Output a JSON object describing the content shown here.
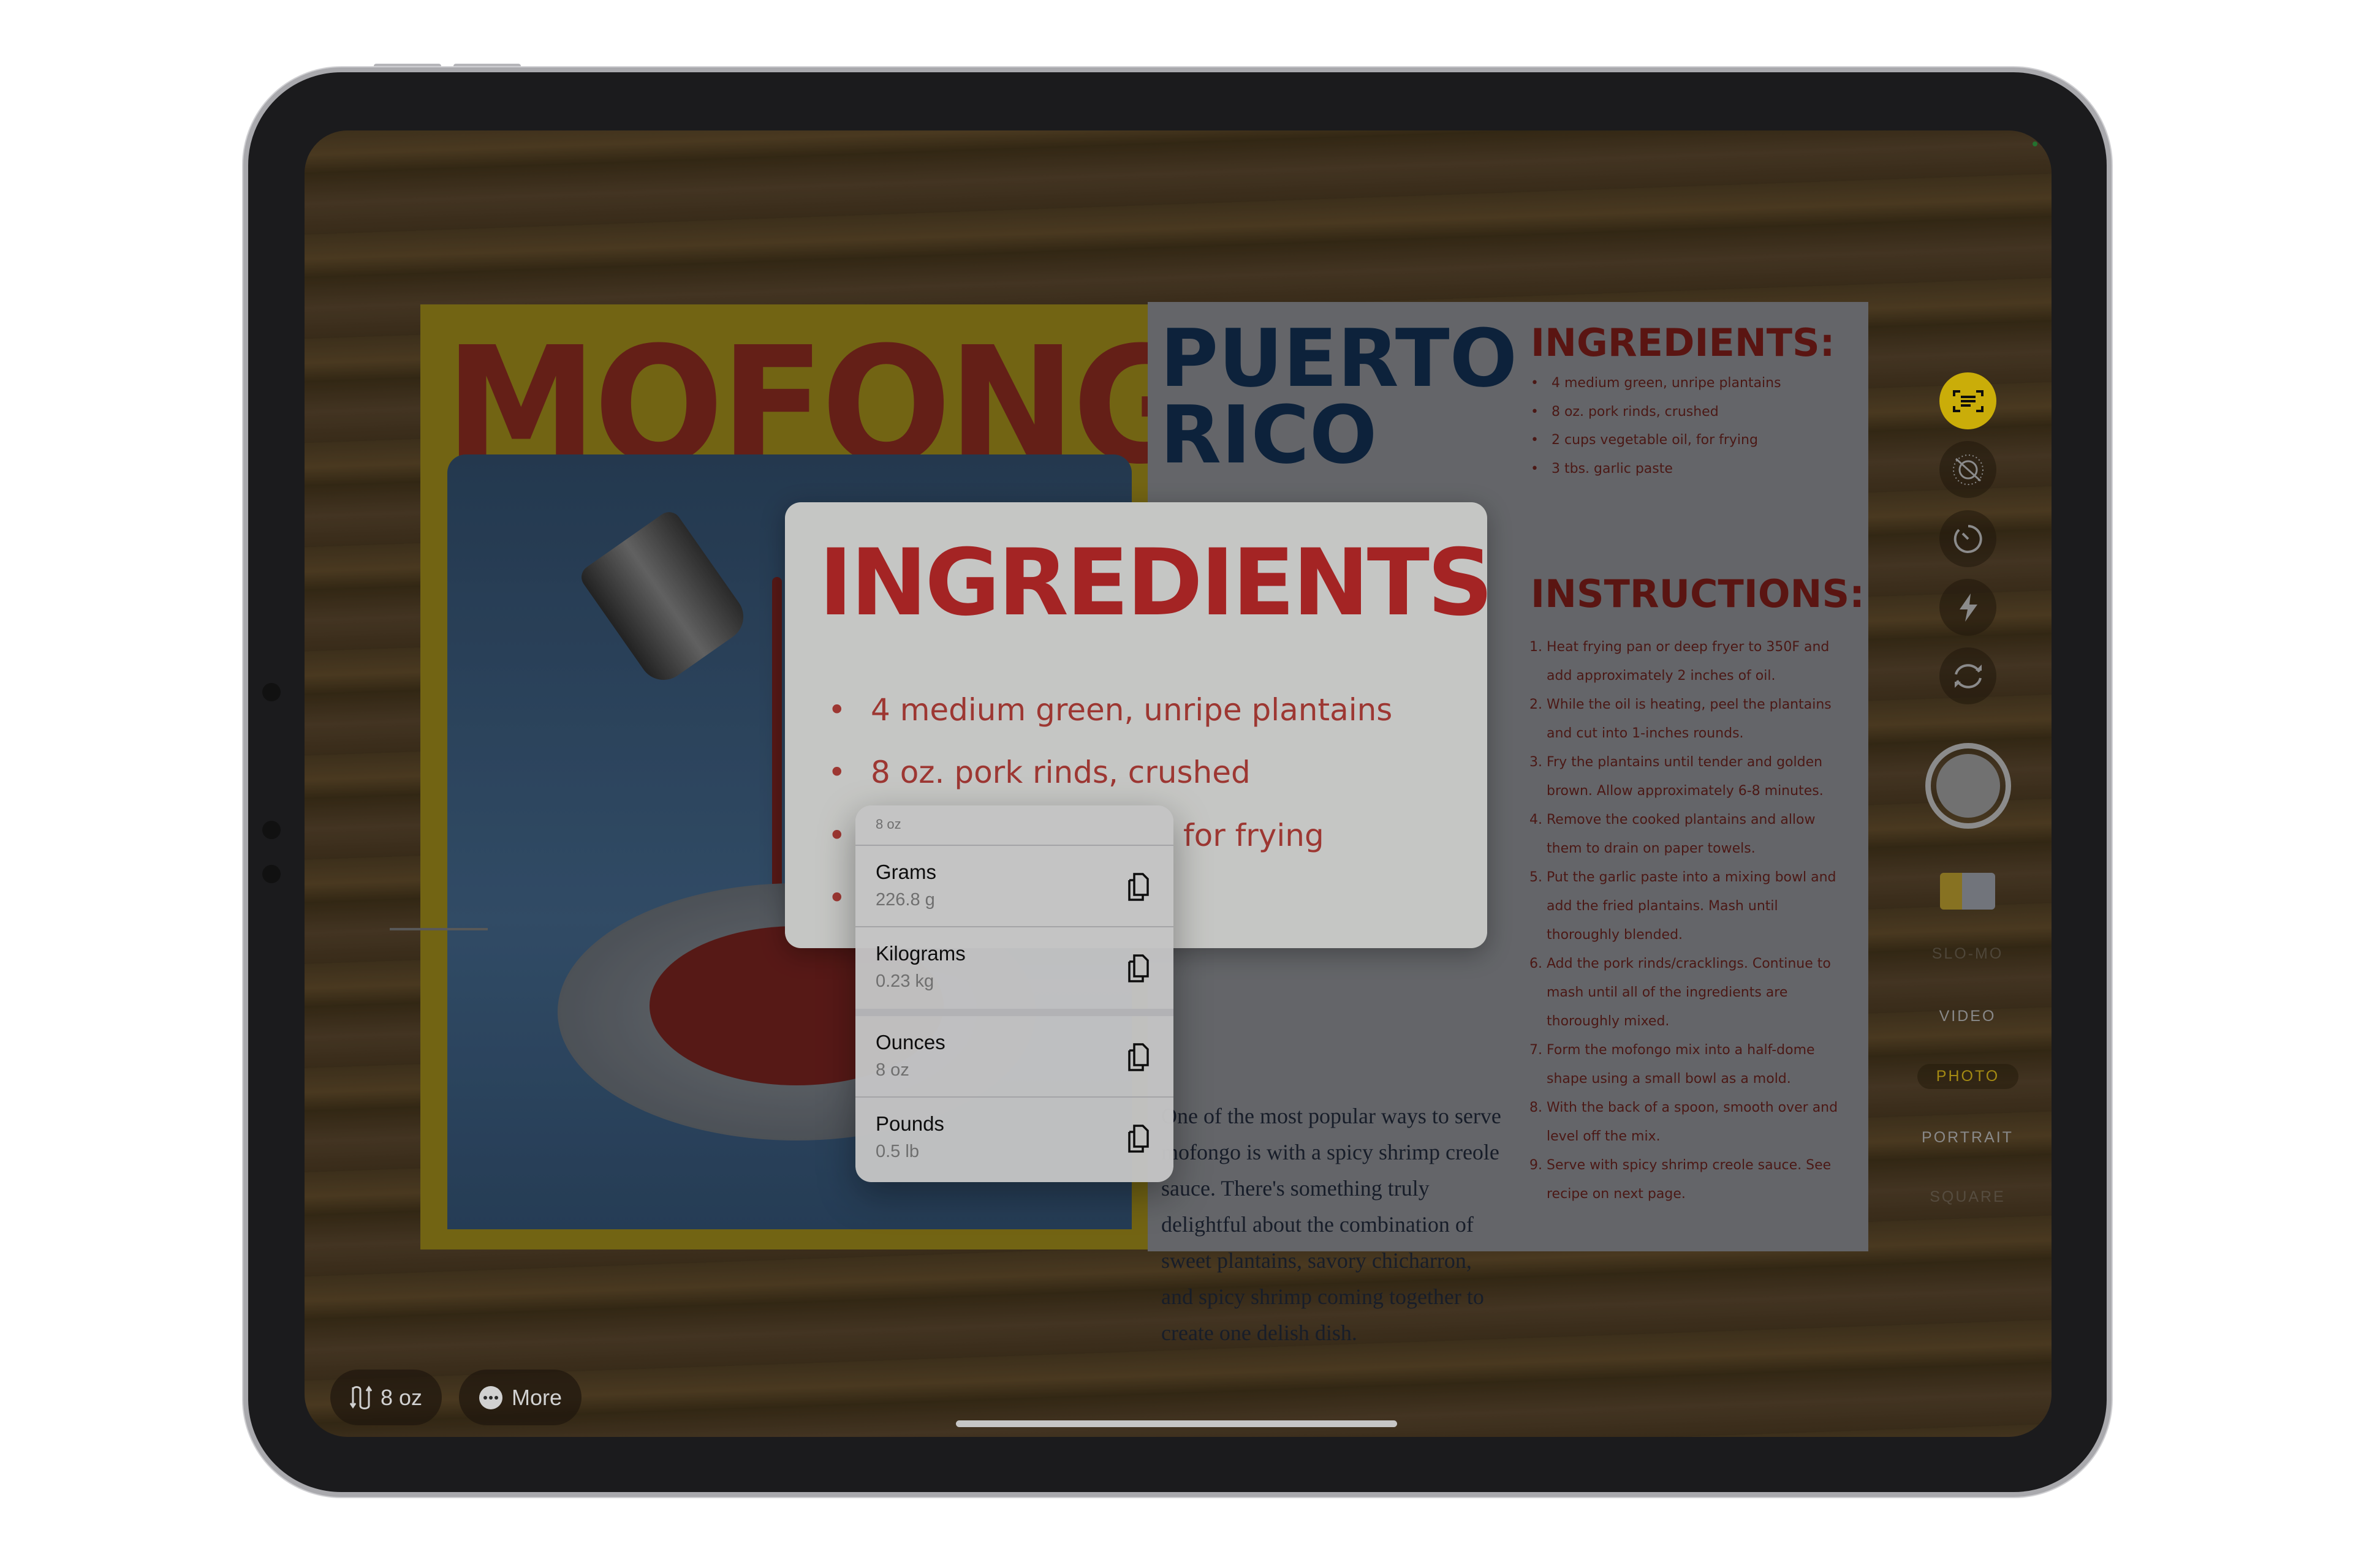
{
  "recipe": {
    "left_title": "MOFONGO",
    "right_title_lines": [
      "PUERTO",
      "RICO"
    ],
    "ingredients_heading": "INGREDIENTS:",
    "ingredients": [
      "4 medium green, unripe plantains",
      "8 oz. pork rinds, crushed",
      "2 cups vegetable oil, for frying",
      "3 tbs. garlic paste"
    ],
    "instructions_heading": "INSTRUCTIONS:",
    "instructions": [
      "Heat frying pan or deep fryer to 350F and add approximately 2 inches of oil.",
      "While the oil is heating, peel the plantains and cut into 1-inches rounds.",
      "Fry the plantains until tender and golden brown. Allow approximately 6-8 minutes.",
      "Remove the cooked plantains and allow them to drain on paper towels.",
      "Put the garlic paste into a mixing bowl and add the fried plantains. Mash until thoroughly blended.",
      "Add the pork rinds/cracklings. Continue to mash until all of the ingredients are thoroughly mixed.",
      "Form the mofongo mix into a half-dome shape using a small bowl as a mold.",
      "With the back of a spoon, smooth over and level off the mix.",
      "Serve with spicy shrimp creole sauce. See recipe on next page."
    ],
    "paragraph": "One of the most popular ways to serve mofongo is with a spicy shrimp creole sauce. There's something truly delightful about the combination of sweet plantains, savory chicharron, and spicy shrimp coming together to create one delish dish."
  },
  "live_text_popup": {
    "heading": "INGREDIENTS:",
    "items": [
      "4 medium green, unripe plantains",
      "8 oz. pork rinds, crushed",
      "for frying"
    ]
  },
  "conversion_menu": {
    "header": "8 oz",
    "options": [
      {
        "label": "Grams",
        "value": "226.8 g",
        "icon": "copy-icon"
      },
      {
        "label": "Kilograms",
        "value": "0.23 kg",
        "icon": "copy-icon"
      },
      {
        "label": "Ounces",
        "value": "8 oz",
        "icon": "copy-icon"
      },
      {
        "label": "Pounds",
        "value": "0.5 lb",
        "icon": "copy-icon"
      }
    ]
  },
  "camera": {
    "controls": [
      "live-text-icon",
      "live-photo-off-icon",
      "timer-icon",
      "flash-icon",
      "switch-camera-icon"
    ],
    "modes": [
      "SLO-MO",
      "VIDEO",
      "PHOTO",
      "PORTRAIT",
      "SQUARE"
    ],
    "selected_mode": "PHOTO",
    "accent": "#f7d40b"
  },
  "bottom_bar": {
    "convert_label": "8 oz",
    "more_label": "More"
  }
}
